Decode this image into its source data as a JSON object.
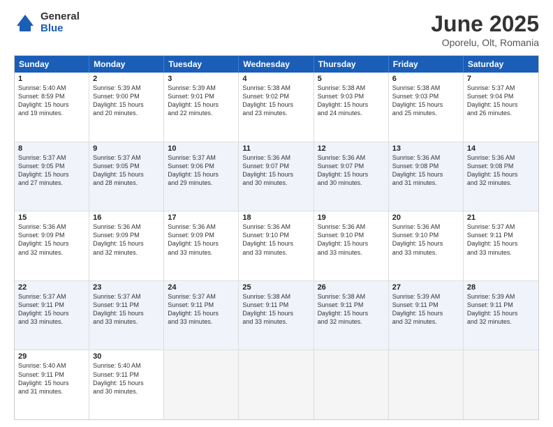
{
  "logo": {
    "general": "General",
    "blue": "Blue"
  },
  "title": "June 2025",
  "subtitle": "Oporelu, Olt, Romania",
  "header_days": [
    "Sunday",
    "Monday",
    "Tuesday",
    "Wednesday",
    "Thursday",
    "Friday",
    "Saturday"
  ],
  "rows": [
    {
      "alt": false,
      "cells": [
        {
          "day": "1",
          "text": "Sunrise: 5:40 AM\nSunset: 8:59 PM\nDaylight: 15 hours\nand 19 minutes."
        },
        {
          "day": "2",
          "text": "Sunrise: 5:39 AM\nSunset: 9:00 PM\nDaylight: 15 hours\nand 20 minutes."
        },
        {
          "day": "3",
          "text": "Sunrise: 5:39 AM\nSunset: 9:01 PM\nDaylight: 15 hours\nand 22 minutes."
        },
        {
          "day": "4",
          "text": "Sunrise: 5:38 AM\nSunset: 9:02 PM\nDaylight: 15 hours\nand 23 minutes."
        },
        {
          "day": "5",
          "text": "Sunrise: 5:38 AM\nSunset: 9:03 PM\nDaylight: 15 hours\nand 24 minutes."
        },
        {
          "day": "6",
          "text": "Sunrise: 5:38 AM\nSunset: 9:03 PM\nDaylight: 15 hours\nand 25 minutes."
        },
        {
          "day": "7",
          "text": "Sunrise: 5:37 AM\nSunset: 9:04 PM\nDaylight: 15 hours\nand 26 minutes."
        }
      ]
    },
    {
      "alt": true,
      "cells": [
        {
          "day": "8",
          "text": "Sunrise: 5:37 AM\nSunset: 9:05 PM\nDaylight: 15 hours\nand 27 minutes."
        },
        {
          "day": "9",
          "text": "Sunrise: 5:37 AM\nSunset: 9:05 PM\nDaylight: 15 hours\nand 28 minutes."
        },
        {
          "day": "10",
          "text": "Sunrise: 5:37 AM\nSunset: 9:06 PM\nDaylight: 15 hours\nand 29 minutes."
        },
        {
          "day": "11",
          "text": "Sunrise: 5:36 AM\nSunset: 9:07 PM\nDaylight: 15 hours\nand 30 minutes."
        },
        {
          "day": "12",
          "text": "Sunrise: 5:36 AM\nSunset: 9:07 PM\nDaylight: 15 hours\nand 30 minutes."
        },
        {
          "day": "13",
          "text": "Sunrise: 5:36 AM\nSunset: 9:08 PM\nDaylight: 15 hours\nand 31 minutes."
        },
        {
          "day": "14",
          "text": "Sunrise: 5:36 AM\nSunset: 9:08 PM\nDaylight: 15 hours\nand 32 minutes."
        }
      ]
    },
    {
      "alt": false,
      "cells": [
        {
          "day": "15",
          "text": "Sunrise: 5:36 AM\nSunset: 9:09 PM\nDaylight: 15 hours\nand 32 minutes."
        },
        {
          "day": "16",
          "text": "Sunrise: 5:36 AM\nSunset: 9:09 PM\nDaylight: 15 hours\nand 32 minutes."
        },
        {
          "day": "17",
          "text": "Sunrise: 5:36 AM\nSunset: 9:09 PM\nDaylight: 15 hours\nand 33 minutes."
        },
        {
          "day": "18",
          "text": "Sunrise: 5:36 AM\nSunset: 9:10 PM\nDaylight: 15 hours\nand 33 minutes."
        },
        {
          "day": "19",
          "text": "Sunrise: 5:36 AM\nSunset: 9:10 PM\nDaylight: 15 hours\nand 33 minutes."
        },
        {
          "day": "20",
          "text": "Sunrise: 5:36 AM\nSunset: 9:10 PM\nDaylight: 15 hours\nand 33 minutes."
        },
        {
          "day": "21",
          "text": "Sunrise: 5:37 AM\nSunset: 9:11 PM\nDaylight: 15 hours\nand 33 minutes."
        }
      ]
    },
    {
      "alt": true,
      "cells": [
        {
          "day": "22",
          "text": "Sunrise: 5:37 AM\nSunset: 9:11 PM\nDaylight: 15 hours\nand 33 minutes."
        },
        {
          "day": "23",
          "text": "Sunrise: 5:37 AM\nSunset: 9:11 PM\nDaylight: 15 hours\nand 33 minutes."
        },
        {
          "day": "24",
          "text": "Sunrise: 5:37 AM\nSunset: 9:11 PM\nDaylight: 15 hours\nand 33 minutes."
        },
        {
          "day": "25",
          "text": "Sunrise: 5:38 AM\nSunset: 9:11 PM\nDaylight: 15 hours\nand 33 minutes."
        },
        {
          "day": "26",
          "text": "Sunrise: 5:38 AM\nSunset: 9:11 PM\nDaylight: 15 hours\nand 32 minutes."
        },
        {
          "day": "27",
          "text": "Sunrise: 5:39 AM\nSunset: 9:11 PM\nDaylight: 15 hours\nand 32 minutes."
        },
        {
          "day": "28",
          "text": "Sunrise: 5:39 AM\nSunset: 9:11 PM\nDaylight: 15 hours\nand 32 minutes."
        }
      ]
    },
    {
      "alt": false,
      "cells": [
        {
          "day": "29",
          "text": "Sunrise: 5:40 AM\nSunset: 9:11 PM\nDaylight: 15 hours\nand 31 minutes."
        },
        {
          "day": "30",
          "text": "Sunrise: 5:40 AM\nSunset: 9:11 PM\nDaylight: 15 hours\nand 30 minutes."
        },
        {
          "day": "",
          "text": "",
          "empty": true
        },
        {
          "day": "",
          "text": "",
          "empty": true
        },
        {
          "day": "",
          "text": "",
          "empty": true
        },
        {
          "day": "",
          "text": "",
          "empty": true
        },
        {
          "day": "",
          "text": "",
          "empty": true
        }
      ]
    }
  ]
}
